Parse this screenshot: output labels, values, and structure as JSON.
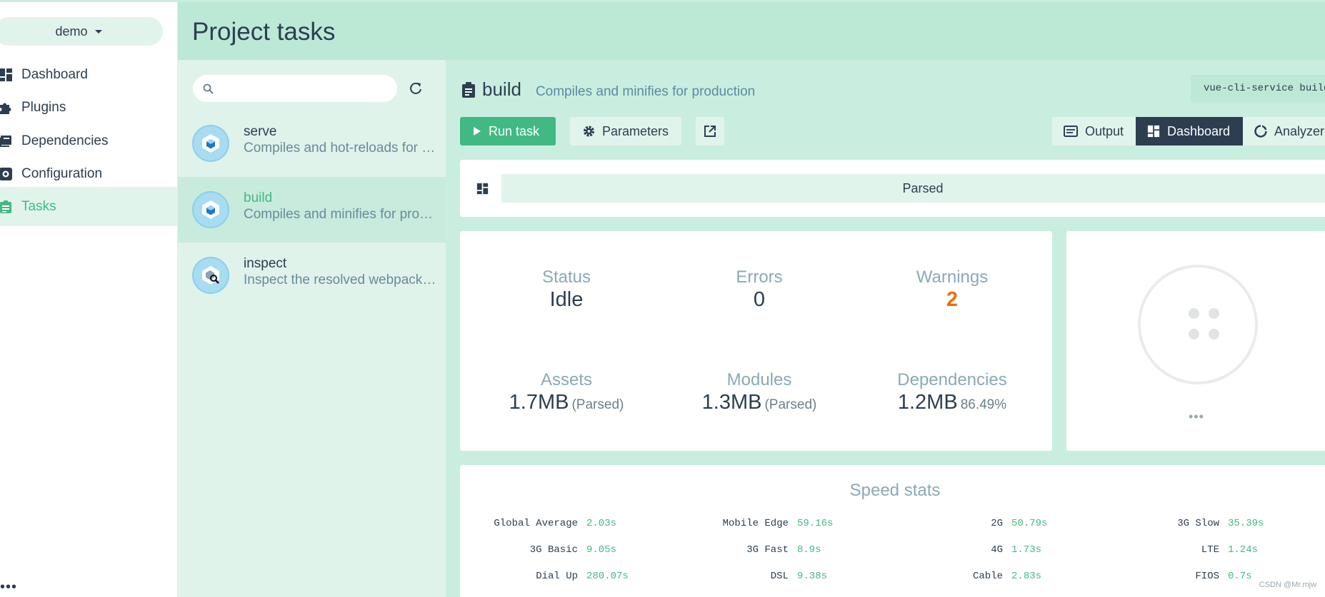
{
  "project": {
    "name": "demo"
  },
  "nav": {
    "items": [
      {
        "label": "Dashboard",
        "icon": "dashboard-icon"
      },
      {
        "label": "Plugins",
        "icon": "puzzle-icon"
      },
      {
        "label": "Dependencies",
        "icon": "book-icon"
      },
      {
        "label": "Configuration",
        "icon": "gear-icon"
      },
      {
        "label": "Tasks",
        "icon": "clipboard-icon",
        "active": true
      }
    ],
    "more": "•••"
  },
  "header": {
    "title": "Project tasks"
  },
  "tasklist": {
    "search_placeholder": "",
    "tasks": [
      {
        "name": "serve",
        "desc": "Compiles and hot-reloads for development"
      },
      {
        "name": "build",
        "desc": "Compiles and minifies for production",
        "active": true
      },
      {
        "name": "inspect",
        "desc": "Inspect the resolved webpack config"
      }
    ]
  },
  "task": {
    "name": "build",
    "desc": "Compiles and minifies for production",
    "command": "vue-cli-service build"
  },
  "toolbar": {
    "run_label": "Run task",
    "params_label": "Parameters",
    "views": [
      "Output",
      "Dashboard",
      "Analyzer"
    ],
    "active_view": "Dashboard"
  },
  "filter": {
    "mode": "Parsed"
  },
  "stats": {
    "status": {
      "label": "Status",
      "value": "Idle"
    },
    "errors": {
      "label": "Errors",
      "value": "0"
    },
    "warnings": {
      "label": "Warnings",
      "value": "2"
    },
    "assets": {
      "label": "Assets",
      "value": "1.7MB",
      "sub": "(Parsed)"
    },
    "modules": {
      "label": "Modules",
      "value": "1.3MB",
      "sub": "(Parsed)"
    },
    "dependencies": {
      "label": "Dependencies",
      "value": "1.2MB",
      "sub": "86.49%"
    }
  },
  "loader": {
    "more": "•••"
  },
  "speed": {
    "title": "Speed stats",
    "rows": [
      [
        [
          "Global Average",
          "2.03s"
        ],
        [
          "Mobile Edge",
          "59.16s"
        ],
        [
          "2G",
          "50.79s"
        ],
        [
          "3G Slow",
          "35.39s"
        ]
      ],
      [
        [
          "3G Basic",
          "9.05s"
        ],
        [
          "3G Fast",
          "8.9s"
        ],
        [
          "4G",
          "1.73s"
        ],
        [
          "LTE",
          "1.24s"
        ]
      ],
      [
        [
          "Dial Up",
          "280.07s"
        ],
        [
          "DSL",
          "9.38s"
        ],
        [
          "Cable",
          "2.83s"
        ],
        [
          "FIOS",
          "0.7s"
        ]
      ]
    ]
  },
  "watermark": "CSDN @Mr.mjw",
  "colors": {
    "accent": "#42b983",
    "dark": "#2c3e50",
    "warning": "#ef6c00",
    "mint": "#c9eee0"
  }
}
